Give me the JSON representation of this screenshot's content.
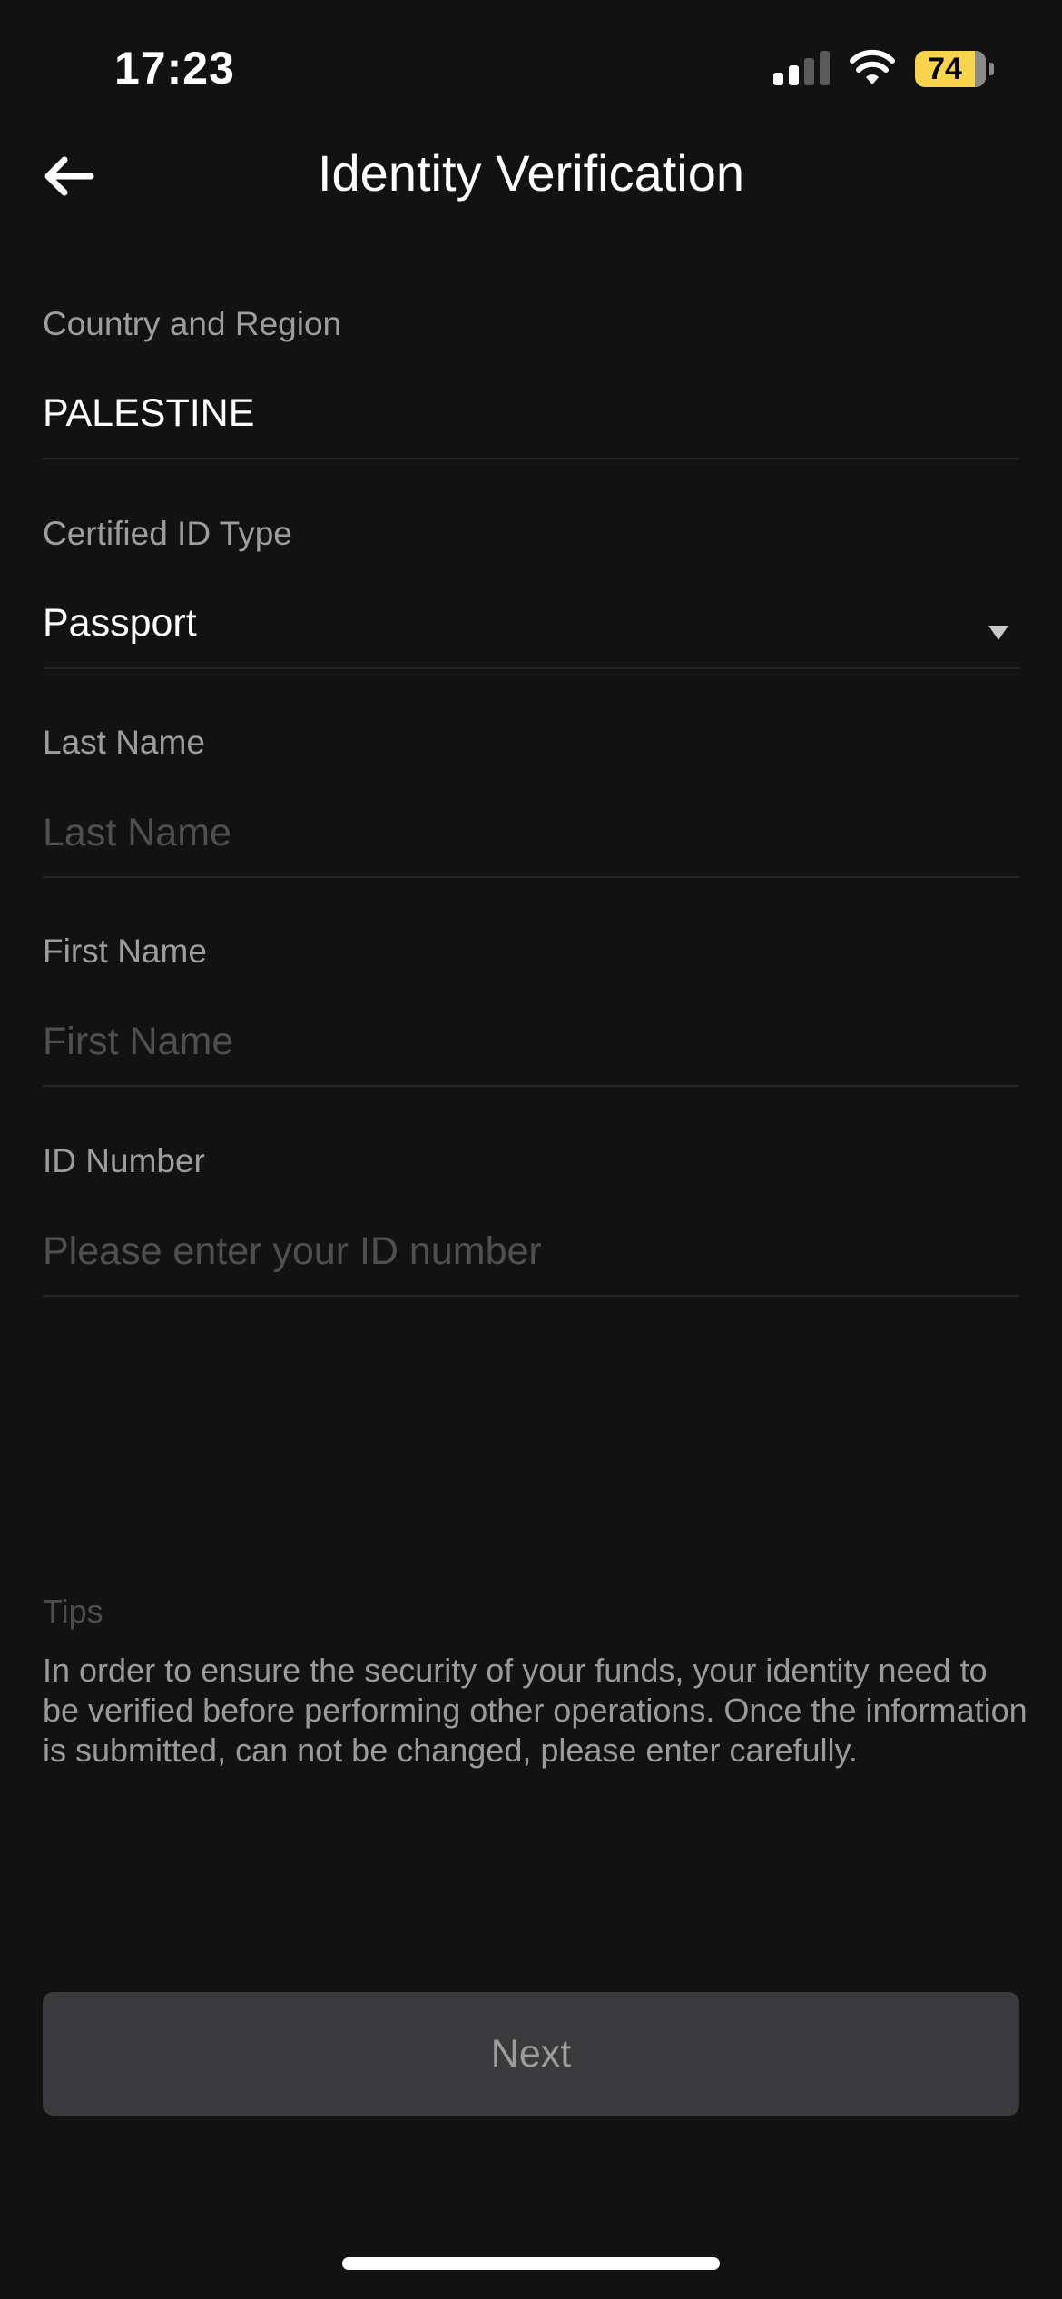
{
  "status_bar": {
    "time": "17:23",
    "battery_level": "74",
    "signal_bars_active": 2,
    "signal_bars_total": 4
  },
  "header": {
    "title": "Identity Verification",
    "back_icon": "arrow-left-icon"
  },
  "form": {
    "country": {
      "label": "Country and Region",
      "value": "PALESTINE"
    },
    "id_type": {
      "label": "Certified ID Type",
      "value": "Passport",
      "icon": "triangle-down-icon"
    },
    "last_name": {
      "label": "Last Name",
      "value": "",
      "placeholder": "Last Name"
    },
    "first_name": {
      "label": "First Name",
      "value": "",
      "placeholder": "First Name"
    },
    "id_number": {
      "label": "ID Number",
      "value": "",
      "placeholder": "Please enter your ID number"
    }
  },
  "tips": {
    "title": "Tips",
    "body": "In order to ensure the security of your funds, your identity need to be verified before performing other operations. Once the information is submitted, can not be changed, please enter carefully."
  },
  "actions": {
    "next_label": "Next"
  },
  "colors": {
    "background": "#121212",
    "battery": "#f7d44c",
    "button_disabled": "#3a3a3c"
  }
}
